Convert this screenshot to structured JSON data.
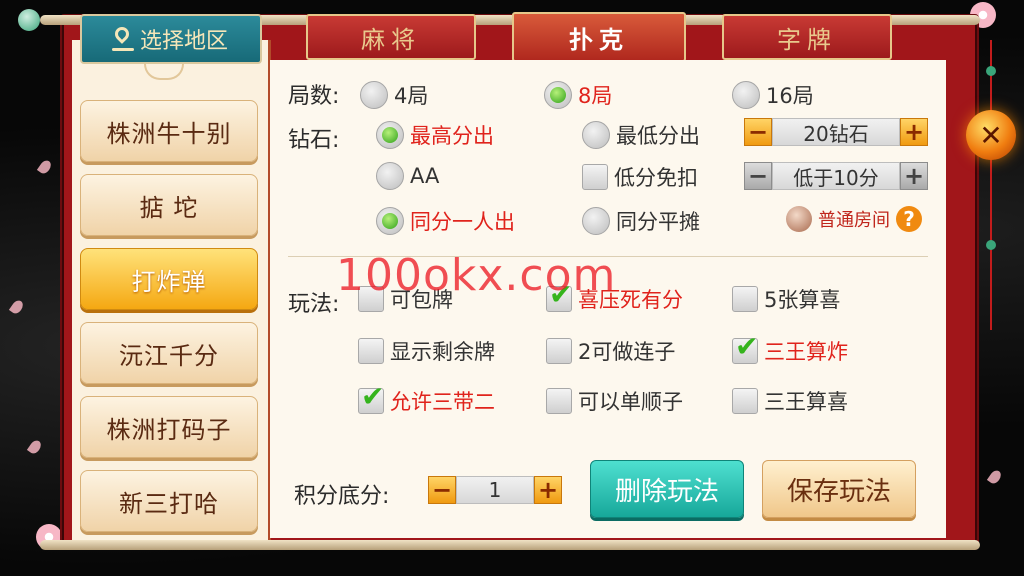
{
  "region": {
    "button_label": "选择地区"
  },
  "sidebar": {
    "items": [
      {
        "label": "株洲牛十别",
        "active": false
      },
      {
        "label": "掂 坨",
        "active": false
      },
      {
        "label": "打炸弹",
        "active": true
      },
      {
        "label": "沅江千分",
        "active": false
      },
      {
        "label": "株洲打码子",
        "active": false
      },
      {
        "label": "新三打哈",
        "active": false
      }
    ]
  },
  "tabs": [
    {
      "label": "麻将",
      "active": false
    },
    {
      "label": "扑克",
      "active": true
    },
    {
      "label": "字牌",
      "active": false
    }
  ],
  "rounds": {
    "label": "局数:",
    "options": [
      {
        "label": "4局",
        "selected": false
      },
      {
        "label": "8局",
        "selected": true
      },
      {
        "label": "16局",
        "selected": false
      }
    ]
  },
  "diamond": {
    "label": "钻石:",
    "pay_options": [
      {
        "label": "最高分出",
        "selected": true
      },
      {
        "label": "最低分出",
        "selected": false
      },
      {
        "label": "AA",
        "selected": false
      }
    ],
    "low_score_waive": {
      "label": "低分免扣",
      "checked": false
    },
    "same_score_options": [
      {
        "label": "同分一人出",
        "selected": true
      },
      {
        "label": "同分平摊",
        "selected": false
      }
    ],
    "diamond_stepper": {
      "value": "20钻石",
      "minus": "−",
      "plus": "+"
    },
    "below_stepper": {
      "value": "低于10分",
      "minus": "−",
      "plus": "+"
    },
    "room_type": "普通房间",
    "help": "?"
  },
  "gameplay": {
    "label": "玩法:",
    "options": [
      {
        "label": "可包牌",
        "checked": false
      },
      {
        "label": "喜压死有分",
        "checked": true
      },
      {
        "label": "5张算喜",
        "checked": false
      },
      {
        "label": "显示剩余牌",
        "checked": false
      },
      {
        "label": "2可做连子",
        "checked": false
      },
      {
        "label": "三王算炸",
        "checked": true
      },
      {
        "label": "允许三带二",
        "checked": true
      },
      {
        "label": "可以单顺子",
        "checked": false
      },
      {
        "label": "三王算喜",
        "checked": false
      }
    ]
  },
  "base_score": {
    "label": "积分底分:",
    "value": "1",
    "minus": "−",
    "plus": "+"
  },
  "actions": {
    "delete_label": "删除玩法",
    "save_label": "保存玩法"
  },
  "close": {
    "label": "✕"
  },
  "watermark": "100okx.com",
  "colors": {
    "accent_red": "#e0231c",
    "active_gold": "#f5a812",
    "delete_teal": "#17a89a",
    "frame_red": "#a1161a"
  }
}
